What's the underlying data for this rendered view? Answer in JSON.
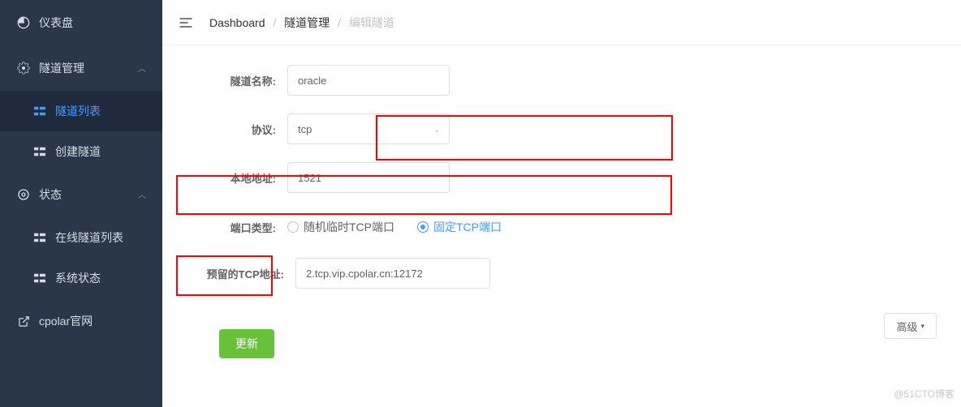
{
  "sidebar": {
    "items": [
      {
        "label": "仪表盘",
        "type": "link"
      },
      {
        "label": "隧道管理",
        "type": "parent"
      },
      {
        "label": "隧道列表",
        "type": "sub",
        "active": true
      },
      {
        "label": "创建隧道",
        "type": "sub"
      },
      {
        "label": "状态",
        "type": "parent"
      },
      {
        "label": "在线隧道列表",
        "type": "sub"
      },
      {
        "label": "系统状态",
        "type": "sub"
      },
      {
        "label": "cpolar官网",
        "type": "link"
      }
    ]
  },
  "breadcrumb": {
    "part1": "Dashboard",
    "part2": "隧道管理",
    "part3": "编辑隧道"
  },
  "form": {
    "labels": {
      "name": "隧道名称:",
      "protocol": "协议:",
      "local": "本地地址:",
      "portType": "端口类型:",
      "reserved": "预留的TCP地址:"
    },
    "values": {
      "name": "oracle",
      "protocol": "tcp",
      "local": "1521",
      "reserved": "2.tcp.vip.cpolar.cn:12172"
    },
    "portType": {
      "random": "随机临时TCP端口",
      "fixed": "固定TCP端口",
      "selected": "fixed"
    }
  },
  "buttons": {
    "advanced": "高级",
    "submit": "更新"
  },
  "watermark": "@51CTO博客"
}
